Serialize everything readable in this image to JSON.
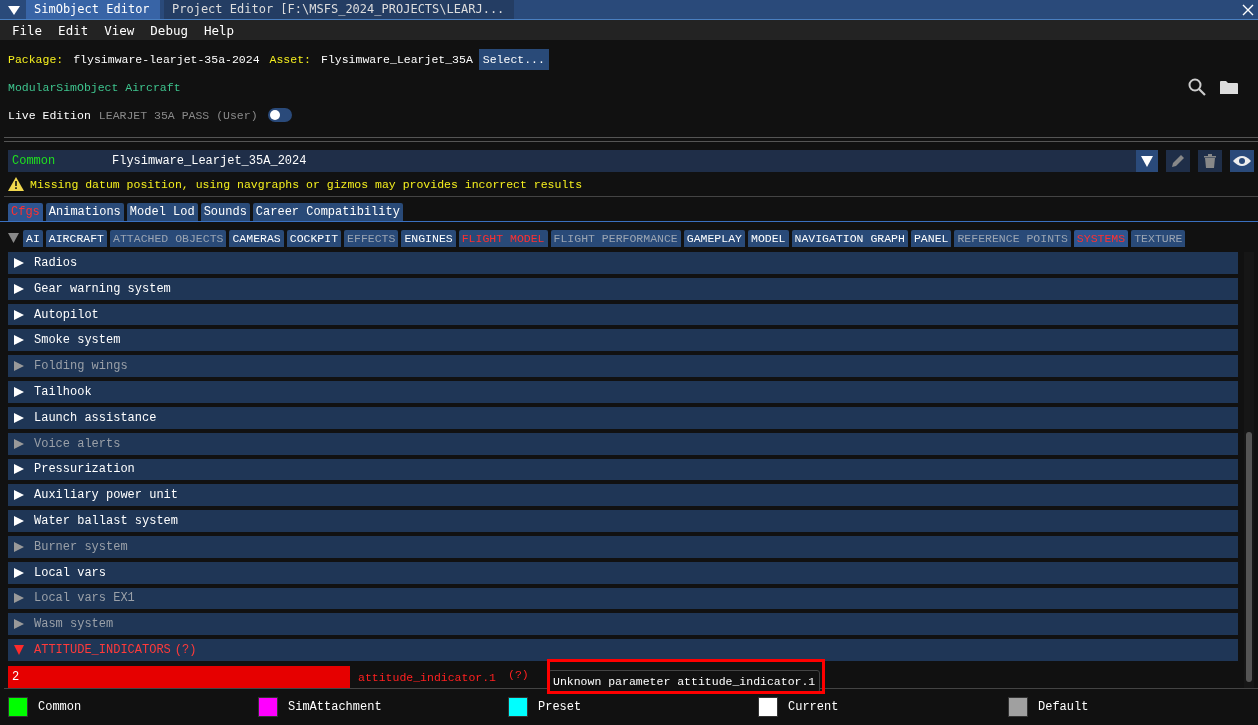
{
  "window": {
    "tabs": [
      {
        "label": "SimObject Editor",
        "selected": true
      },
      {
        "label": "Project Editor [F:\\MSFS_2024_PROJECTS\\LEARJ...",
        "selected": false
      }
    ]
  },
  "menu": [
    "File",
    "Edit",
    "View",
    "Debug",
    "Help"
  ],
  "package": {
    "label": "Package:",
    "value": "flysimware-learjet-35a-2024",
    "asset_label": "Asset:",
    "asset_value": "Flysimware_Learjet_35A",
    "select_button": "Select..."
  },
  "object_class": "ModularSimObject Aircraft",
  "live_edition": {
    "label": "Live Edition",
    "value": "LEARJET 35A PASS (User)",
    "on": false
  },
  "layer": {
    "name": "Common",
    "value": "Flysimware_Learjet_35A_2024"
  },
  "warning": "Missing datum position, using navgraphs or gizmos may provides incorrect results",
  "tabs": [
    {
      "label": "Cfgs",
      "selected": true,
      "error": true
    },
    {
      "label": "Animations",
      "selected": false,
      "error": false
    },
    {
      "label": "Model Lod",
      "selected": false,
      "error": false
    },
    {
      "label": "Sounds",
      "selected": false,
      "error": false
    },
    {
      "label": "Career Compatibility",
      "selected": false,
      "error": false
    }
  ],
  "subtabs": [
    {
      "label": "AI",
      "selected": false,
      "kind": "normal"
    },
    {
      "label": "AIRCRAFT",
      "selected": false,
      "kind": "normal"
    },
    {
      "label": "ATTACHED OBJECTS",
      "selected": false,
      "kind": "empty"
    },
    {
      "label": "CAMERAS",
      "selected": false,
      "kind": "normal"
    },
    {
      "label": "COCKPIT",
      "selected": false,
      "kind": "normal"
    },
    {
      "label": "EFFECTS",
      "selected": false,
      "kind": "empty"
    },
    {
      "label": "ENGINES",
      "selected": false,
      "kind": "normal"
    },
    {
      "label": "FLIGHT MODEL",
      "selected": false,
      "kind": "error"
    },
    {
      "label": "FLIGHT PERFORMANCE",
      "selected": false,
      "kind": "empty"
    },
    {
      "label": "GAMEPLAY",
      "selected": false,
      "kind": "normal"
    },
    {
      "label": "MODEL",
      "selected": false,
      "kind": "normal"
    },
    {
      "label": "NAVIGATION GRAPH",
      "selected": false,
      "kind": "normal"
    },
    {
      "label": "PANEL",
      "selected": false,
      "kind": "normal"
    },
    {
      "label": "REFERENCE POINTS",
      "selected": false,
      "kind": "empty"
    },
    {
      "label": "SYSTEMS",
      "selected": true,
      "kind": "error"
    },
    {
      "label": "TEXTURE",
      "selected": false,
      "kind": "empty"
    }
  ],
  "sections": [
    {
      "label": "Radios",
      "kind": "normal",
      "expanded": false
    },
    {
      "label": "Gear warning system",
      "kind": "normal",
      "expanded": false
    },
    {
      "label": "Autopilot",
      "kind": "normal",
      "expanded": false
    },
    {
      "label": "Smoke system",
      "kind": "normal",
      "expanded": false
    },
    {
      "label": "Folding wings",
      "kind": "empty",
      "expanded": false
    },
    {
      "label": "Tailhook",
      "kind": "normal",
      "expanded": false
    },
    {
      "label": "Launch assistance",
      "kind": "normal",
      "expanded": false
    },
    {
      "label": "Voice alerts",
      "kind": "empty",
      "expanded": false
    },
    {
      "label": "Pressurization",
      "kind": "normal",
      "expanded": false
    },
    {
      "label": "Auxiliary power unit",
      "kind": "normal",
      "expanded": false
    },
    {
      "label": "Water ballast system",
      "kind": "normal",
      "expanded": false
    },
    {
      "label": "Burner system",
      "kind": "empty",
      "expanded": false
    },
    {
      "label": "Local vars",
      "kind": "normal",
      "expanded": false
    },
    {
      "label": "Local vars EX1",
      "kind": "empty",
      "expanded": false
    },
    {
      "label": "Wasm system",
      "kind": "empty",
      "expanded": false
    },
    {
      "label": "ATTITUDE_INDICATORS",
      "help": "(?)",
      "kind": "error",
      "expanded": true,
      "params": [
        {
          "value": "2",
          "name": "attitude_indicator.1",
          "help": "(?)",
          "error": true
        }
      ]
    }
  ],
  "tooltip": "Unknown parameter attitude_indicator.1",
  "legend": [
    {
      "label": "Common",
      "color": "#00ff00"
    },
    {
      "label": "SimAttachment",
      "color": "#ff00ff"
    },
    {
      "label": "Preset",
      "color": "#00ffff"
    },
    {
      "label": "Current",
      "color": "#ffffff"
    },
    {
      "label": "Default",
      "color": "#a0a0a0"
    }
  ]
}
